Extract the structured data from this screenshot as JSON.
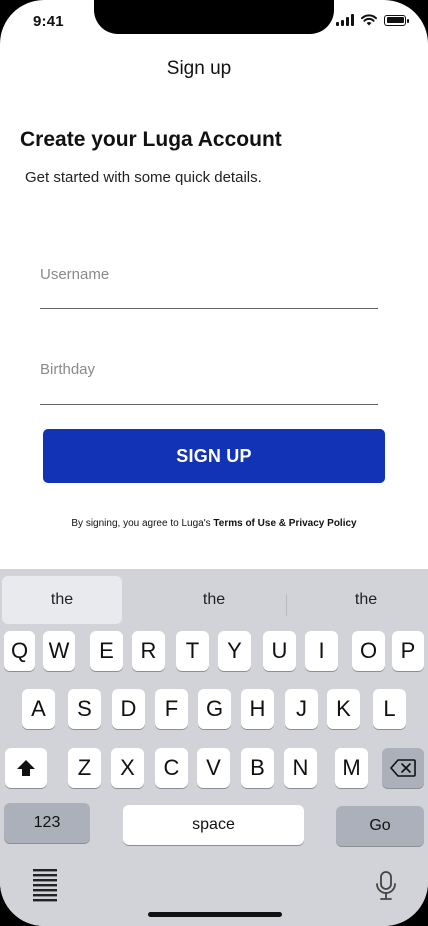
{
  "status_bar": {
    "time": "9:41"
  },
  "nav": {
    "title": "Sign up"
  },
  "header": {
    "title": "Create your Luga Account",
    "subtitle": "Get started with some quick details."
  },
  "form": {
    "username_label": "Username",
    "birthday_label": "Birthday",
    "submit_label": "SIGN UP"
  },
  "terms": {
    "prefix": "By signing, you agree to Luga's ",
    "links": "Terms of Use & Privacy Policy"
  },
  "keyboard": {
    "suggestions": [
      "the",
      "the",
      "the"
    ],
    "row1": [
      "Q",
      "W",
      "E",
      "R",
      "T",
      "Y",
      "U",
      "I",
      "O",
      "P"
    ],
    "row2": [
      "A",
      "S",
      "D",
      "F",
      "G",
      "H",
      "J",
      "K",
      "L"
    ],
    "row3": [
      "Z",
      "X",
      "C",
      "V",
      "B",
      "N",
      "M"
    ],
    "numbers_label": "123",
    "space_label": "space",
    "go_label": "Go"
  }
}
